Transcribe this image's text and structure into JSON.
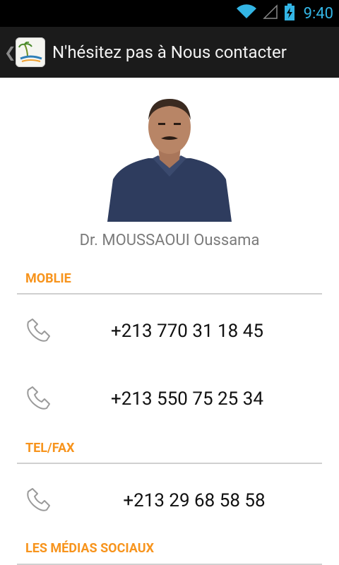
{
  "status_bar": {
    "time": "9:40"
  },
  "action_bar": {
    "up_glyph": "❮",
    "title": "N'hésitez pas à Nous contacter"
  },
  "contact": {
    "name": "Dr. MOUSSAOUI Oussama"
  },
  "sections": {
    "mobile": {
      "label": "MOBLIE",
      "numbers": [
        "+213 770 31 18 45",
        "+213 550 75 25 34"
      ]
    },
    "telfax": {
      "label": "TEL/FAX",
      "numbers": [
        "+213 29 68 58 58"
      ]
    },
    "social": {
      "label": "LES MÉDIAS SOCIAUX"
    }
  },
  "icons": {
    "phone": "phone-icon",
    "wifi": "wifi-icon",
    "signal": "signal-icon",
    "battery": "battery-charging-icon",
    "logo": "app-logo"
  },
  "colors": {
    "accent": "#f7941d",
    "status_blue": "#33b5e5",
    "action_bar": "#1b1b1b",
    "divider": "#d0d0d0"
  }
}
